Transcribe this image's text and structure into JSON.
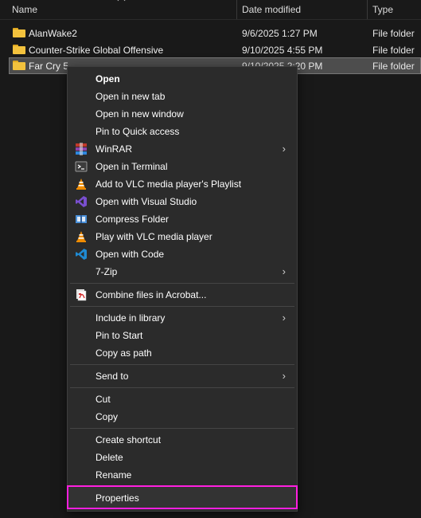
{
  "columns": {
    "name": "Name",
    "date_modified": "Date modified",
    "type": "Type"
  },
  "files": [
    {
      "name": "AlanWake2",
      "date": "9/6/2025 1:27 PM",
      "type": "File folder"
    },
    {
      "name": "Counter-Strike Global Offensive",
      "date": "9/10/2025 4:55 PM",
      "type": "File folder"
    },
    {
      "name": "Far Cry 5",
      "date": "9/10/2025 2:20 PM",
      "type": "File folder"
    }
  ],
  "context_menu": {
    "items": [
      {
        "label": "Open",
        "icon": ""
      },
      {
        "label": "Open in new tab",
        "icon": ""
      },
      {
        "label": "Open in new window",
        "icon": ""
      },
      {
        "label": "Pin to Quick access",
        "icon": ""
      },
      {
        "label": "WinRAR",
        "icon": "winrar-icon"
      },
      {
        "label": "Open in Terminal",
        "icon": "terminal-icon"
      },
      {
        "label": "Add to VLC media player's Playlist",
        "icon": "vlc-icon"
      },
      {
        "label": "Open with Visual Studio",
        "icon": "visual-studio-icon"
      },
      {
        "label": "Compress Folder",
        "icon": "compress-icon"
      },
      {
        "label": "Play with VLC media player",
        "icon": "vlc-icon"
      },
      {
        "label": "Open with Code",
        "icon": "vscode-icon"
      },
      {
        "label": "7-Zip",
        "icon": ""
      },
      {
        "label": "Combine files in Acrobat...",
        "icon": "acrobat-icon"
      },
      {
        "label": "Include in library",
        "icon": ""
      },
      {
        "label": "Pin to Start",
        "icon": ""
      },
      {
        "label": "Copy as path",
        "icon": ""
      },
      {
        "label": "Send to",
        "icon": ""
      },
      {
        "label": "Cut",
        "icon": ""
      },
      {
        "label": "Copy",
        "icon": ""
      },
      {
        "label": "Create shortcut",
        "icon": ""
      },
      {
        "label": "Delete",
        "icon": ""
      },
      {
        "label": "Rename",
        "icon": ""
      },
      {
        "label": "Properties",
        "icon": ""
      }
    ]
  },
  "colors": {
    "background": "#191919",
    "menu_background": "#2b2b2b",
    "highlight_outline": "#ff1fe0",
    "folder_yellow": "#f3c23d"
  }
}
